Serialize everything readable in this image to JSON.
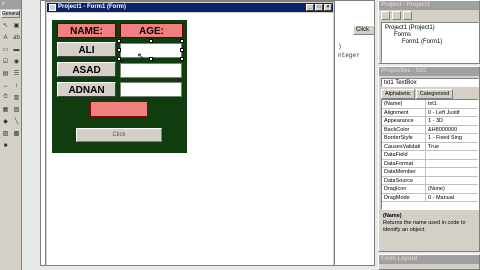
{
  "toolbox": {
    "title": "General",
    "tools": [
      "pointer-icon",
      "picture-icon",
      "label-tool-icon",
      "textbox-tool-icon",
      "frame-tool-icon",
      "commandbutton-tool-icon",
      "checkbox-tool-icon",
      "optionbutton-tool-icon",
      "combobox-tool-icon",
      "listbox-tool-icon",
      "hscroll-tool-icon",
      "vscroll-tool-icon",
      "timer-tool-icon",
      "drivelist-tool-icon",
      "dirlist-tool-icon",
      "filelist-tool-icon",
      "shape-tool-icon",
      "line-tool-icon",
      "image-tool-icon",
      "data-tool-icon",
      "ole-tool-icon"
    ]
  },
  "code": {
    "line1": ")",
    "line2": "nteger",
    "click_label": "Click"
  },
  "form_window": {
    "title": "Project1 - Form1 (Form)"
  },
  "green_form": {
    "name_label": "NAME:",
    "age_label": "AGE:",
    "rows": [
      "ALI",
      "ASAD",
      "ADNAN"
    ],
    "click_button": "Click",
    "colors": {
      "background": "#0f3d0f",
      "header": "#f08080"
    }
  },
  "project": {
    "title": "Project - Project1",
    "tree": [
      "Project1 (Project1)",
      "Forms",
      "Form1 (Form1)"
    ]
  },
  "properties": {
    "title": "Properties - txt1",
    "object": "txt1 TextBox",
    "tabs": [
      "Alphabetic",
      "Categorized"
    ],
    "rows": [
      {
        "name": "(Name)",
        "value": "txt1"
      },
      {
        "name": "Alignment",
        "value": "0 - Left Justif"
      },
      {
        "name": "Appearance",
        "value": "1 - 3D"
      },
      {
        "name": "BackColor",
        "value": "&H8000000"
      },
      {
        "name": "BorderStyle",
        "value": "1 - Fixed Sing"
      },
      {
        "name": "CausesValidati",
        "value": "True"
      },
      {
        "name": "DataField",
        "value": ""
      },
      {
        "name": "DataFormat",
        "value": ""
      },
      {
        "name": "DataMember",
        "value": ""
      },
      {
        "name": "DataSource",
        "value": ""
      },
      {
        "name": "DragIcon",
        "value": "(None)"
      },
      {
        "name": "DragMode",
        "value": "0 - Manual"
      }
    ],
    "desc_title": "(Name)",
    "desc_text": "Returns the name used in code to identify an object."
  },
  "form_layout": {
    "title": "Form Layout"
  }
}
